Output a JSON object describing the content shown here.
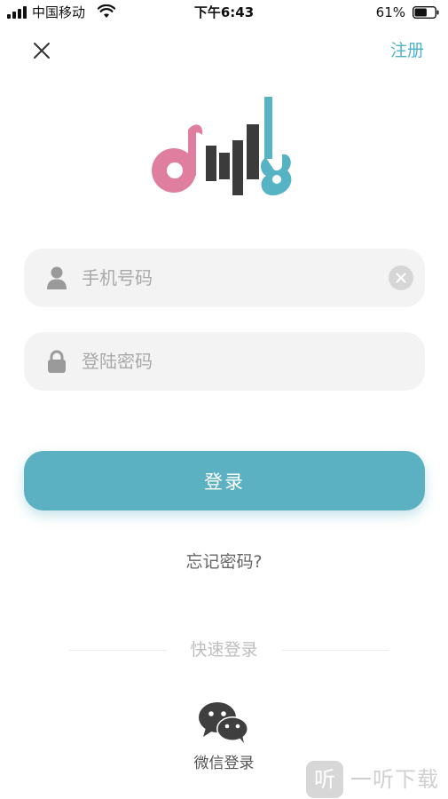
{
  "status_bar": {
    "carrier": "中国移动",
    "time": "下午6:43",
    "battery_percent": "61%",
    "battery_level": 0.61
  },
  "nav": {
    "close_icon": "close-icon",
    "register_label": "注册"
  },
  "logo": {
    "icon": "music-logo-icon"
  },
  "form": {
    "phone": {
      "value": "",
      "placeholder": "手机号码",
      "icon": "user-icon",
      "clear_icon": "clear-icon"
    },
    "password": {
      "value": "",
      "placeholder": "登陆密码",
      "icon": "lock-icon"
    },
    "login_label": "登录",
    "forgot_label": "忘记密码?"
  },
  "quick_login": {
    "label": "快速登录",
    "wechat": {
      "icon": "wechat-icon",
      "label": "微信登录"
    }
  },
  "watermark": {
    "glyph": "听",
    "text": "一听下载"
  },
  "colors": {
    "accent": "#5bb1c2",
    "link": "#4fb2c7",
    "logo_pink": "#e07ea0",
    "logo_dark": "#3b3b3b",
    "logo_teal": "#55b3c4",
    "field_bg": "#f3f3f3"
  }
}
